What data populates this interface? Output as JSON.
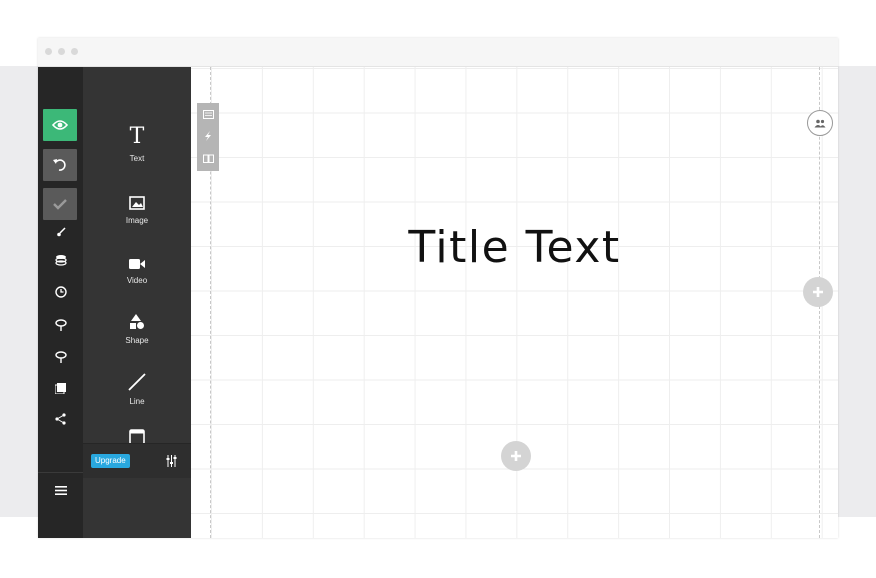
{
  "window": {
    "controls": [
      "close",
      "minimize",
      "maximize"
    ]
  },
  "rail": {
    "buttons": [
      {
        "name": "preview",
        "icon": "eye-icon",
        "color": "#3cb878"
      },
      {
        "name": "undo",
        "icon": "undo-icon",
        "color": "#5a5a5a"
      },
      {
        "name": "confirm",
        "icon": "check-icon",
        "color": "#5a5a5a"
      }
    ],
    "icons": [
      "brush-icon",
      "layers-icon",
      "clock-icon",
      "pin-icon",
      "pin-icon",
      "gallery-icon",
      "share-icon"
    ],
    "menu_icon": "hamburger-icon"
  },
  "panel": {
    "tools": [
      {
        "label": "Text",
        "glyph": "T",
        "icon": "text-icon"
      },
      {
        "label": "Image",
        "icon": "image-icon"
      },
      {
        "label": "Video",
        "icon": "video-icon"
      },
      {
        "label": "Shape",
        "icon": "shape-icon"
      },
      {
        "label": "Line",
        "icon": "line-icon"
      },
      {
        "label": "",
        "icon": "window-icon"
      }
    ],
    "upgrade_label": "Upgrade",
    "settings_icon": "sliders-icon"
  },
  "canvas": {
    "title": "Title Text",
    "mini_toolbar": [
      "layout-icon",
      "bolt-icon",
      "book-icon"
    ],
    "collab_icon": "users-icon",
    "add_icon": "plus-icon"
  },
  "colors": {
    "accent_green": "#3cb878",
    "upgrade_blue": "#29a8df",
    "rail_bg": "#262626",
    "panel_bg": "#343434"
  }
}
